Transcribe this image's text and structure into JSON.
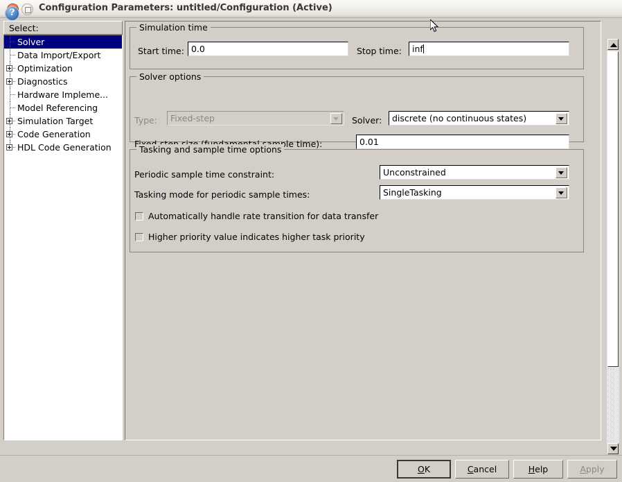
{
  "window": {
    "title": "Configuration Parameters: untitled/Configuration (Active)",
    "close_icon": "close-icon",
    "maximize_icon": "maximize-icon"
  },
  "sidebar": {
    "header": "Select:",
    "items": [
      {
        "label": "Solver",
        "expandable": false,
        "selected": true
      },
      {
        "label": "Data Import/Export",
        "expandable": false,
        "selected": false
      },
      {
        "label": "Optimization",
        "expandable": true,
        "selected": false
      },
      {
        "label": "Diagnostics",
        "expandable": true,
        "selected": false
      },
      {
        "label": "Hardware Impleme...",
        "expandable": false,
        "selected": false
      },
      {
        "label": "Model Referencing",
        "expandable": false,
        "selected": false
      },
      {
        "label": "Simulation Target",
        "expandable": true,
        "selected": false
      },
      {
        "label": "Code Generation",
        "expandable": true,
        "selected": false
      },
      {
        "label": "HDL Code Generation",
        "expandable": true,
        "selected": false
      }
    ]
  },
  "main": {
    "simulation_time": {
      "title": "Simulation time",
      "start_label": "Start time:",
      "start_value": "0.0",
      "stop_label": "Stop time:",
      "stop_value": "inf"
    },
    "solver_options": {
      "title": "Solver options",
      "type_label": "Type:",
      "type_value": "Fixed-step",
      "solver_label": "Solver:",
      "solver_value": "discrete (no continuous states)",
      "fixed_step_label": "Fixed-step size (fundamental sample time):",
      "fixed_step_value": "0.01"
    },
    "tasking_options": {
      "title": "Tasking and sample time options",
      "constraint_label": "Periodic sample time constraint:",
      "constraint_value": "Unconstrained",
      "mode_label": "Tasking mode for periodic sample times:",
      "mode_value": "SingleTasking",
      "checkbox_auto_rate": "Automatically handle rate transition for data transfer",
      "checkbox_priority": "Higher priority value indicates higher task priority"
    }
  },
  "footer": {
    "help_icon": "help-icon",
    "ok": "OK",
    "ok_mnemonic": "O",
    "cancel": "Cancel",
    "cancel_mnemonic": "C",
    "help": "Help",
    "help_mnemonic": "H",
    "apply": "Apply",
    "apply_mnemonic": "A"
  },
  "colors": {
    "panel": "#d3cfc8",
    "selection": "#000080",
    "field": "#ffffff",
    "disabled_text": "#8d887f"
  }
}
